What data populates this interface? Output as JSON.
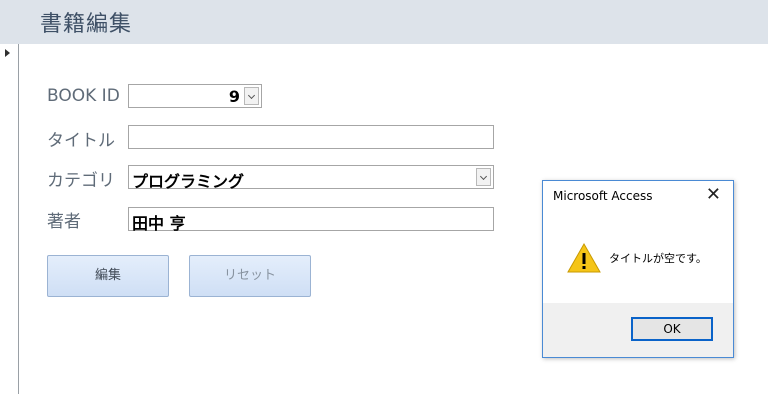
{
  "header": {
    "title": "書籍編集"
  },
  "form": {
    "book_id": {
      "label": "BOOK ID",
      "value": "9"
    },
    "title": {
      "label": "タイトル",
      "value": ""
    },
    "category": {
      "label": "カテゴリ",
      "value": "プログラミング"
    },
    "author": {
      "label": "著者",
      "value": "田中 亨"
    },
    "buttons": {
      "edit": "編集",
      "reset": "リセット"
    }
  },
  "dialog": {
    "title": "Microsoft Access",
    "close": "✕",
    "message": "タイトルが空です。",
    "ok": "OK",
    "icon": "warning-icon"
  },
  "colors": {
    "header_bg": "#dde3ea",
    "dialog_border": "#4a8ad4",
    "button_bg": "#cfdff5",
    "warning": "#f5c518"
  }
}
